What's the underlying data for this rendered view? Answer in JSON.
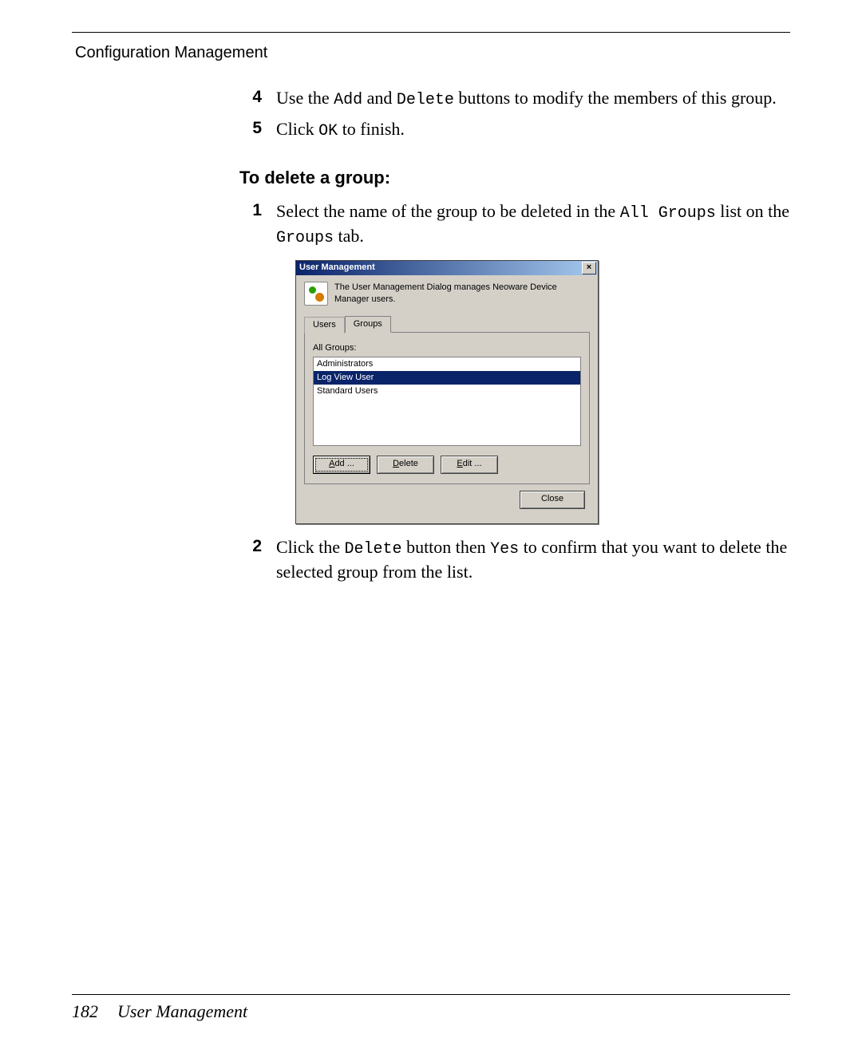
{
  "header": {
    "running": "Configuration Management"
  },
  "steps_a": [
    {
      "num": "4",
      "pre1": "Use the ",
      "mono1": "Add",
      "mid": " and ",
      "mono2": "Delete",
      "post": " buttons to modify the members of this group."
    },
    {
      "num": "5",
      "pre1": "Click ",
      "mono1": "OK",
      "post": " to finish."
    }
  ],
  "subhead": "To delete a group:",
  "steps_b": [
    {
      "num": "1",
      "pre1": "Select the name of the group to be deleted in the ",
      "mono1": "All Groups",
      "mid": " list on the ",
      "mono2": "Groups",
      "post": " tab."
    },
    {
      "num": "2",
      "pre1": "Click the ",
      "mono1": "Delete",
      "mid": " button then ",
      "mono2": "Yes",
      "post": " to confirm that you want to delete the selected group from the list."
    }
  ],
  "dialog": {
    "title": "User Management",
    "desc": "The User Management Dialog manages Neoware Device Manager users.",
    "tabs": {
      "users": "Users",
      "groups": "Groups"
    },
    "panel_label": "All Groups:",
    "groups": [
      "Administrators",
      "Log View User",
      "Standard Users"
    ],
    "selected_index": 1,
    "buttons": {
      "add": "Add ...",
      "delete": "Delete",
      "edit": "Edit ..."
    },
    "close": "Close"
  },
  "footer": {
    "page": "182",
    "chapter": "User Management"
  }
}
